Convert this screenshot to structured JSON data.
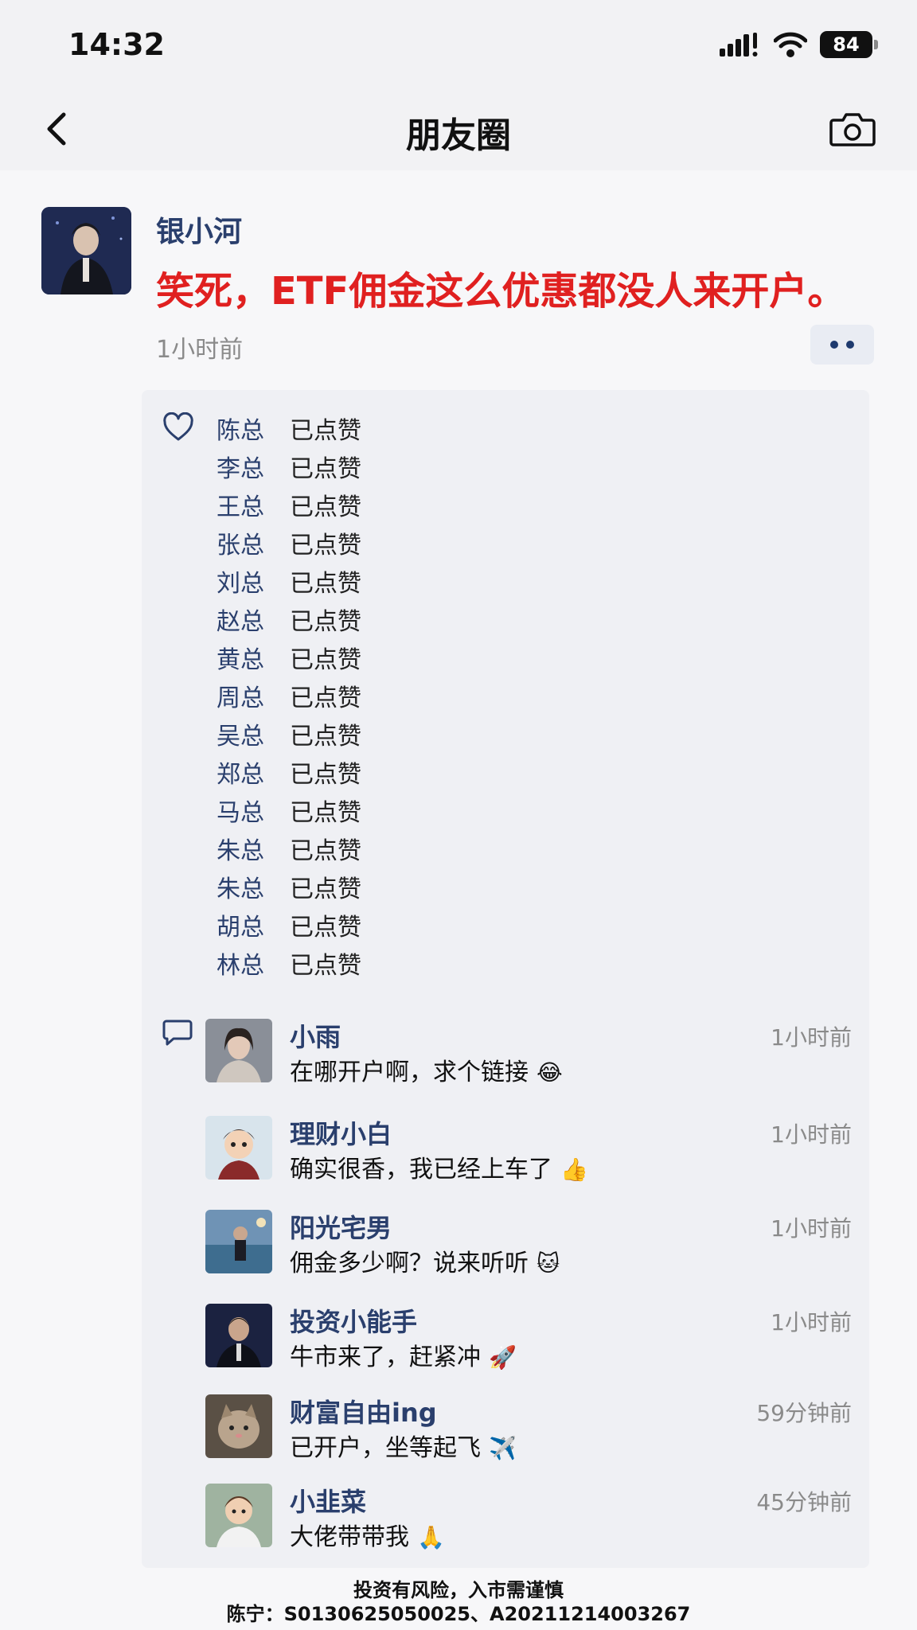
{
  "status_bar": {
    "time": "14:32",
    "battery": "84",
    "icons": [
      "signal-icon",
      "wifi-icon",
      "battery-icon"
    ]
  },
  "nav": {
    "title": "朋友圈",
    "icons": [
      "back-chevron-icon",
      "camera-icon"
    ]
  },
  "post": {
    "author": "银小河",
    "text": "笑死，ETF佣金这么优惠都没人来开户。",
    "time": "1小时前",
    "text_color": "#e02020",
    "name_color": "#2a3f6d"
  },
  "likes": [
    {
      "name": "陈总",
      "status": "已点赞"
    },
    {
      "name": "李总",
      "status": "已点赞"
    },
    {
      "name": "王总",
      "status": "已点赞"
    },
    {
      "name": "张总",
      "status": "已点赞"
    },
    {
      "name": "刘总",
      "status": "已点赞"
    },
    {
      "name": "赵总",
      "status": "已点赞"
    },
    {
      "name": "黄总",
      "status": "已点赞"
    },
    {
      "name": "周总",
      "status": "已点赞"
    },
    {
      "name": "吴总",
      "status": "已点赞"
    },
    {
      "name": "郑总",
      "status": "已点赞"
    },
    {
      "name": "马总",
      "status": "已点赞"
    },
    {
      "name": "朱总",
      "status": "已点赞"
    },
    {
      "name": "朱总",
      "status": "已点赞"
    },
    {
      "name": "胡总",
      "status": "已点赞"
    },
    {
      "name": "林总",
      "status": "已点赞"
    }
  ],
  "comments": [
    {
      "name": "小雨",
      "text": "在哪开户啊，求个链接",
      "emoji": "😂",
      "time": "1小时前"
    },
    {
      "name": "理财小白",
      "text": "确实很香，我已经上车了",
      "emoji": "👍",
      "time": "1小时前"
    },
    {
      "name": "阳光宅男",
      "text": "佣金多少啊？说来听听",
      "emoji": "🐱",
      "time": "1小时前"
    },
    {
      "name": "投资小能手",
      "text": "牛市来了，赶紧冲",
      "emoji": "🚀",
      "time": "1小时前"
    },
    {
      "name": "财富自由ing",
      "text": "已开户，坐等起飞",
      "emoji": "✈️",
      "time": "59分钟前"
    },
    {
      "name": "小韭菜",
      "text": "大佬带带我",
      "emoji": "🙏",
      "time": "45分钟前"
    }
  ],
  "footer": {
    "risk": "投资有风险，入市需谨慎",
    "license": "陈宁：S0130625050025、A20211214003267"
  }
}
